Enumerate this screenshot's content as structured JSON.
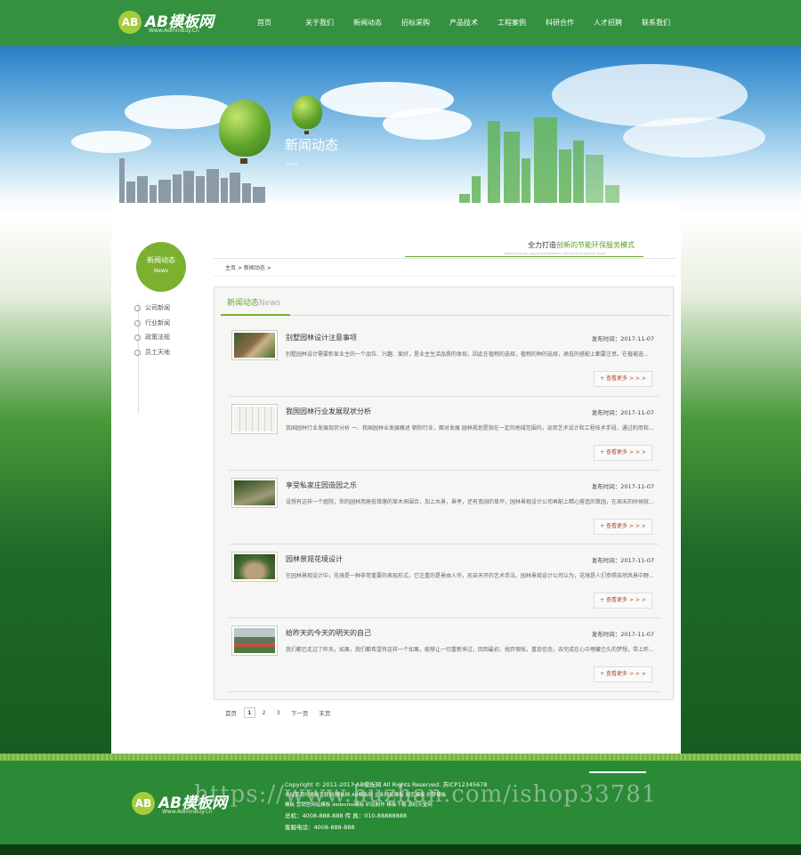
{
  "header": {
    "logo_mark": "AB",
    "logo_text": "AB模板网",
    "logo_sub": "Www.AdminBuy.Cn",
    "nav": [
      "首页",
      "关于我们",
      "新闻动态",
      "招标采购",
      "产品技术",
      "工程案例",
      "科研合作",
      "人才招聘",
      "联系我们"
    ]
  },
  "banner": {
    "title": "新闻动态",
    "subtitle": "News"
  },
  "sidebar": {
    "title": "新闻动态",
    "subtitle": "News",
    "items": [
      "公司新闻",
      "行业新闻",
      "政策法规",
      "员工天地"
    ]
  },
  "slogan": {
    "prefix": "全力打造",
    "highlight": "创新的节能环保服务模式",
    "sub": "ENERGY-SAVING AND ENVIRONMENTAL PROTECTION SERVICE MODE"
  },
  "breadcrumb": {
    "home": "主页",
    "sep": ">",
    "current": "新闻动态"
  },
  "panel": {
    "title": "新闻动态",
    "title_en": "News"
  },
  "news": [
    {
      "title": "别墅园林设计注意事项",
      "date": "发布时间：2017-11-07",
      "desc": "别墅园林设计需要彰显业主的一个品位、兴趣、爱好，是业主生活品质的体现，因此在植物的选择，植物的种的选择，高低的搭配上都要注意。在植被选...",
      "more": "+ 查看更多 > > >"
    },
    {
      "title": "我国园林行业发展现状分析",
      "date": "发布时间：2017-11-07",
      "desc": "我国园林行业发展现状分析 一、我国园林业发展概述 朝阳行业，面对发展 园林规划是指在一定的地域范围内，运用艺术设计和工程技术手段，通过利用和...",
      "more": "+ 查看更多 > > >"
    },
    {
      "title": "享受私家庄园造园之乐",
      "date": "发布时间：2017-11-07",
      "desc": "设想有这样一个庭院，你的园林用高低错落的草木来围合，加上水景，景亭，还有宽阔的草坪，园林景观设计公司再配上精心营造的草园，在周末的时候就...",
      "more": "+ 查看更多 > > >"
    },
    {
      "title": "园林景观花境设计",
      "date": "发布时间：2017-11-07",
      "desc": "在园林景观设计中，花境是一种非常重要的表现形式，它注重的是景由人作，宛自天开的艺术手法。园林景观设计公司认为，花境是人们参照自然风景中野...",
      "more": "+ 查看更多 > > >"
    },
    {
      "title": "给昨天的今天的明天的自己",
      "date": "发布时间：2017-11-07",
      "desc": "我们都已走过了昨天，如果，我们都希望有这样一个如果，能够让一切重新来过，回到最初，抛弃惆怅，重拾信念，去完成在心中埋藏已久的梦想，带上昨...",
      "more": "+ 查看更多 > > >"
    }
  ],
  "pager": {
    "first": "首页",
    "pages": [
      "1",
      "2",
      "3"
    ],
    "current": "1",
    "next": "下一页",
    "last": "末页"
  },
  "footer": {
    "logo_text": "AB模板网",
    "logo_sub": "Www.AdminBuy.Cn",
    "copyright": "Copyright © 2011-2017 AB模板网 All Rights Reserved.    苏ICP12345678",
    "line2": "本站资源均来自互联网 模板网 AB模板网 企业网站模板 网页模板 织梦模板",
    "line3": "模板 营销型网站模板 dedecms模板 织站制作 模板下载 源码天堂网",
    "phone": "总机：4008-888-888    传 真：010-88888888",
    "service": "客服电话：4008-888-888",
    "watermark": "https://www.huzhan.com/ishop33781"
  }
}
